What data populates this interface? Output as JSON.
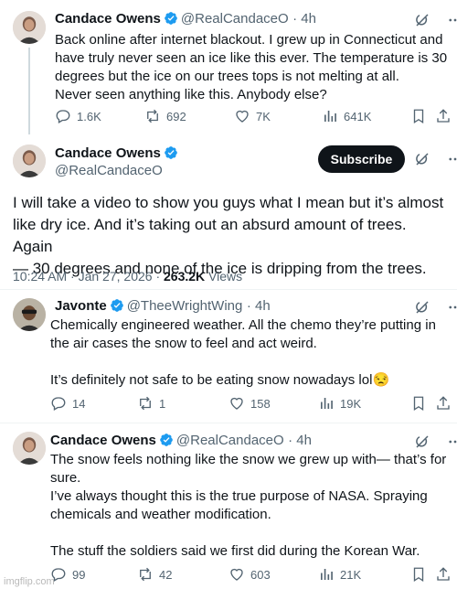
{
  "tweets": [
    {
      "name": "Candace Owens",
      "handle": "@RealCandaceO",
      "time": "· 4h",
      "lines": [
        "Back online after internet blackout. I grew up in Connecticut and",
        "have truly never seen an ice like this ever. The temperature is 30",
        "degrees but the ice on our trees tops is not melting at all.",
        "Never seen anything like this. Anybody else?"
      ],
      "replies": "1.6K",
      "reposts": "692",
      "likes": "7K",
      "views": "641K"
    },
    {
      "name": "Javonte",
      "handle": "@TheeWrightWing",
      "time": "· 4h",
      "lines": [
        "Chemically engineered weather. All the chemo they’re putting in",
        "the air cases the snow to feel and act weird.",
        "",
        "It’s definitely not safe to be eating snow nowadays lol😒"
      ],
      "replies": "14",
      "reposts": "1",
      "likes": "158",
      "views": "19K"
    },
    {
      "name": "Candace Owens",
      "handle": "@RealCandaceO",
      "time": "· 4h",
      "lines": [
        "The snow feels nothing like the snow we grew up with— that’s for",
        "sure.",
        "I’ve always thought this is the true purpose of NASA. Spraying",
        "chemicals and weather modification.",
        "",
        "The stuff the soldiers said we first did during the Korean War."
      ],
      "replies": "99",
      "reposts": "42",
      "likes": "603",
      "views": "21K"
    }
  ],
  "main": {
    "name": "Candace Owens",
    "handle": "@RealCandaceO",
    "subscribe_label": "Subscribe",
    "lines": [
      "I will take a video to show you guys what I mean but it’s almost",
      "like dry ice. And it’s taking out an absurd amount of trees. Again",
      "— 30 degrees and none of the ice is dripping from the trees."
    ],
    "timestamp": "10:24 AM · Jan 27, 2026 · ",
    "views_count": "263.2K",
    "views_label": " Views"
  },
  "watermark": "imgflip.com",
  "colors": {
    "verified": "#1d9bf0",
    "muted": "#536471",
    "text": "#0f1419"
  },
  "icons": [
    "grok-icon",
    "more-icon",
    "reply-icon",
    "repost-icon",
    "like-icon",
    "views-icon",
    "bookmark-icon",
    "share-icon",
    "verified-badge-icon"
  ]
}
